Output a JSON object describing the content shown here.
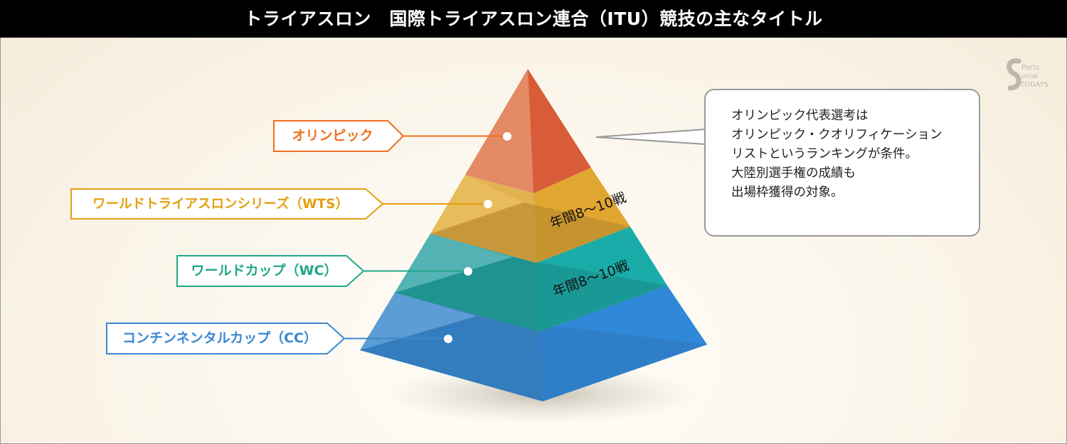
{
  "title": "トライアスロン　国際トライアスロン連合（ITU）競技の主なタイトル",
  "logo_text": "Sports Social Todays",
  "tiers": [
    {
      "label": "オリンピック",
      "color": "#f07020"
    },
    {
      "label": "ワールドトライアスロンシリーズ（WTS）",
      "color": "#e4a010"
    },
    {
      "label": "ワールドカップ（WC）",
      "color": "#20a888"
    },
    {
      "label": "コンチンネンタルカップ（CC）",
      "color": "#3a88d0"
    }
  ],
  "annotations": {
    "wts_games": "年間8〜10戦",
    "wc_games": "年間8〜10戦"
  },
  "note_lines": [
    "オリンピック代表選考は",
    "オリンピック・クオリフィケーション",
    "リストというランキングが条件。",
    "大陸別選手権の成績も",
    "出場枠獲得の対象。"
  ]
}
